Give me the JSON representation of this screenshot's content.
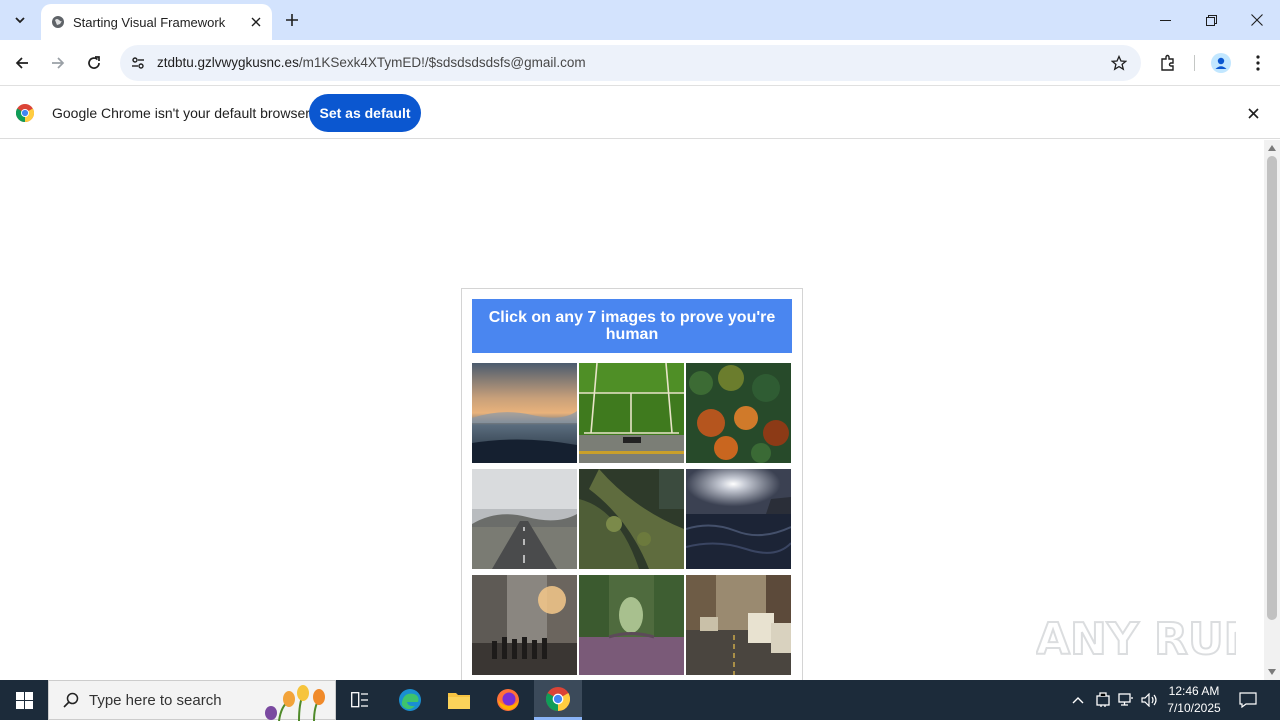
{
  "browser": {
    "tab": {
      "title": "Starting Visual Framework"
    },
    "omnibox": {
      "host": "ztdbtu.gzlvwygkusnc.es",
      "path": "/m1KSexk4XTymED!/$sdsdsdsdsfs@gmail.com"
    },
    "infobar": {
      "message": "Google Chrome isn't your default browser",
      "button": "Set as default"
    }
  },
  "captcha": {
    "instruction": "Click on any 7 images to prove you're human",
    "tiles": [
      "beach-sunset",
      "tennis-court",
      "autumn-forest",
      "misty-road",
      "mossy-tree",
      "ocean-sun",
      "city-street-crowd",
      "tree-tunnel",
      "tram-street"
    ]
  },
  "watermark": {
    "text": "ANY RUN"
  },
  "taskbar": {
    "search_placeholder": "Type here to search",
    "time": "12:46 AM",
    "date": "7/10/2025"
  },
  "colors": {
    "tabstrip": "#d3e3fd",
    "accent": "#0b57d0",
    "captcha_header": "#4a86f0",
    "taskbar": "#1c2b3a"
  }
}
